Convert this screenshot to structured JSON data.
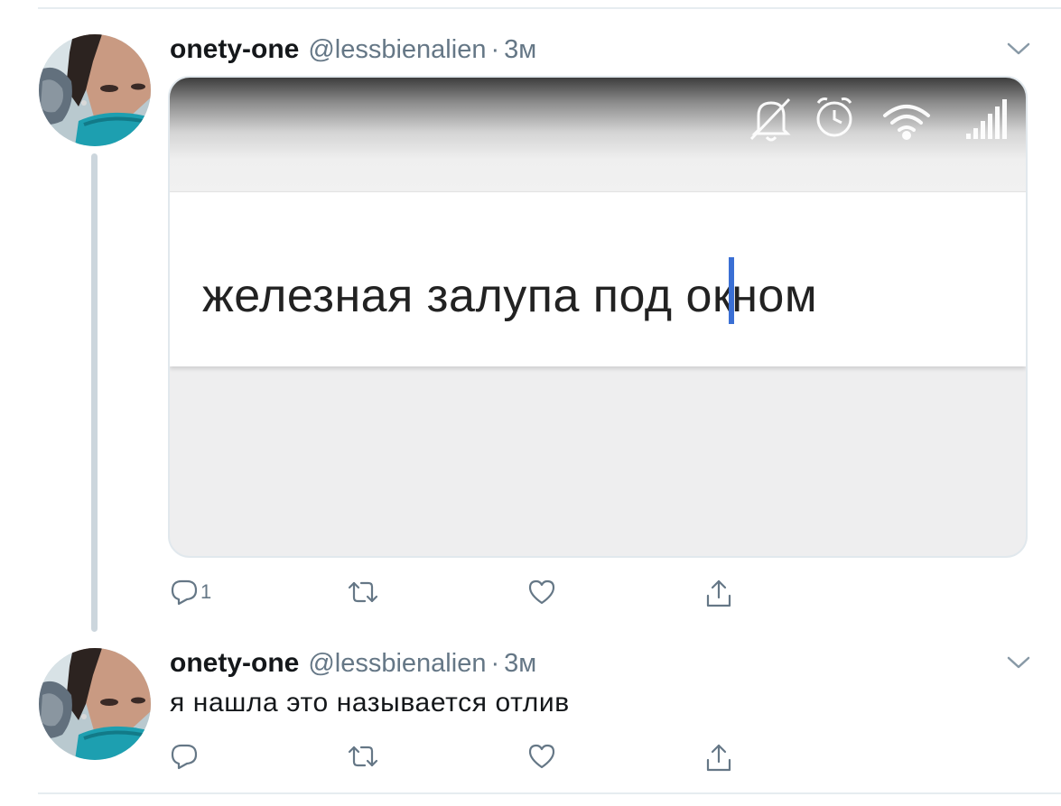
{
  "tweets": [
    {
      "name": "onety-one",
      "handle": "@lessbienalien",
      "separator": "·",
      "time": "3м",
      "text": "",
      "media": {
        "typed_text_before_cursor": "железная залупа под ок",
        "typed_text_after_cursor": "ном",
        "cursor_color": "#3a6fd4",
        "status_icons": [
          "bell-muted-icon",
          "alarm-icon",
          "wifi-icon",
          "signal-icon"
        ]
      },
      "actions": {
        "reply_count": "1",
        "retweet_count": "",
        "like_count": ""
      }
    },
    {
      "name": "onety-one",
      "handle": "@lessbienalien",
      "separator": "·",
      "time": "3м",
      "text": "я нашла это называется отлив",
      "actions": {
        "reply_count": "",
        "retweet_count": "",
        "like_count": ""
      }
    }
  ],
  "colors": {
    "secondary_text": "#657786",
    "thread_line": "#ccd6dd",
    "icon": "#657786"
  }
}
